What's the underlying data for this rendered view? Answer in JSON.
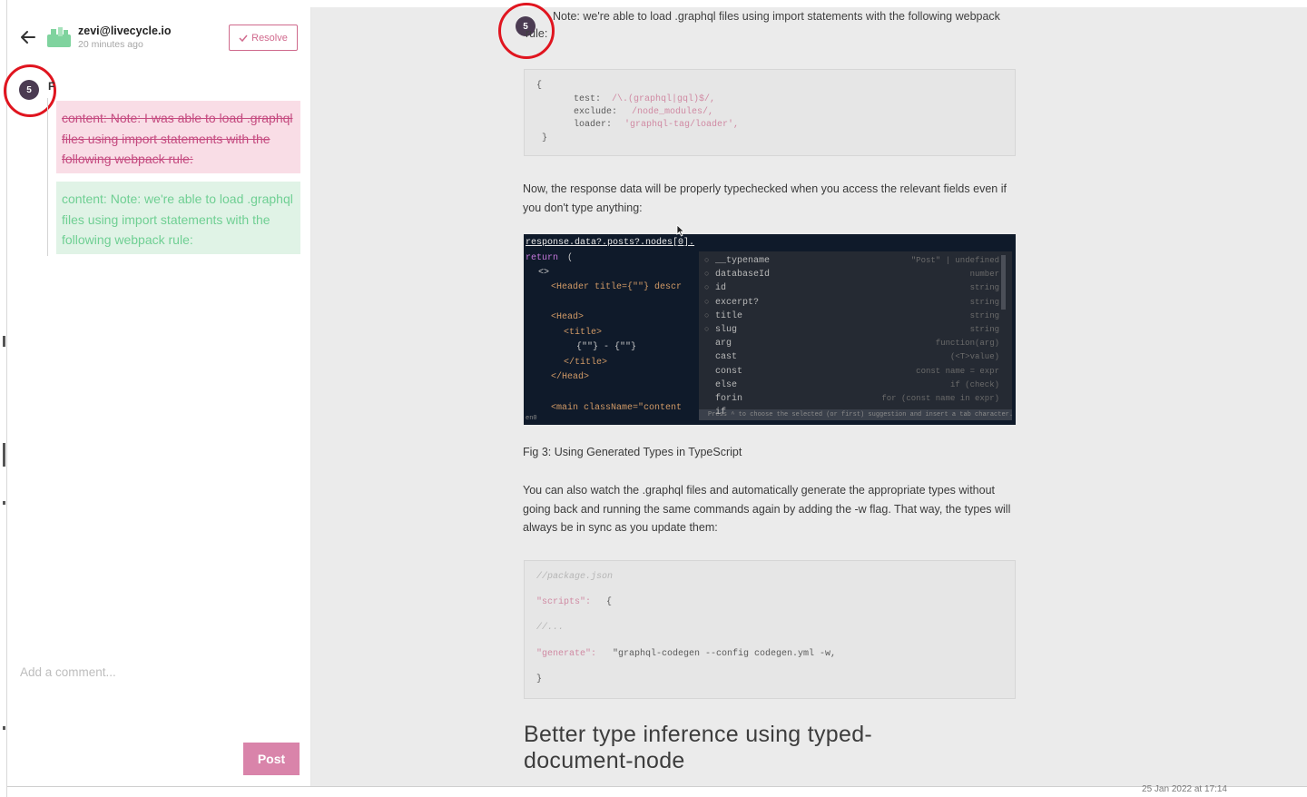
{
  "comment_panel": {
    "user": {
      "email": "zevi@livecycle.io",
      "time": "20 minutes ago"
    },
    "resolve_label": "Resolve",
    "marker_number": "5",
    "marker_letter": "F",
    "removed_text": "content: Note: I was able to load .graphql files using import statements with the following webpack rule:",
    "added_text": "content: Note: we're able to load .graphql files using import statements with the following webpack rule:",
    "comment_placeholder": "Add a comment...",
    "post_label": "Post"
  },
  "article": {
    "marker_number": "5",
    "intro_line": "Note: we're able to load .graphql files using import statements with the following webpack",
    "intro_cont": "rule:",
    "code1": {
      "open": "{",
      "test_key": "test:",
      "test_val": "/\\.(graphql|gql)$/,",
      "exclude_key": "exclude:",
      "exclude_val": "/node_modules/,",
      "loader_key": "loader:",
      "loader_val": "'graphql-tag/loader',",
      "close": "}"
    },
    "para1": "Now, the response data will be properly typechecked when you access the relevant fields even if you don't type anything:",
    "figure": {
      "line1": "response.data?.posts?.nodes[0].",
      "return_kw": "return",
      "return_paren": "(",
      "frag_open": "<>",
      "header_line": "<Header title={\"\"} descr",
      "head_open": "<Head>",
      "title_open": "<title>",
      "title_expr": "{\"\"} - {\"\"}",
      "title_close": "</title>",
      "head_close": "</Head>",
      "main_line": "<main className=\"content",
      "status_left": "en0",
      "suggestions": [
        {
          "name": "__typename",
          "type": "\"Post\" | undefined"
        },
        {
          "name": "databaseId",
          "type": "number"
        },
        {
          "name": "id",
          "type": "string"
        },
        {
          "name": "excerpt?",
          "type": "string"
        },
        {
          "name": "title",
          "type": "string"
        },
        {
          "name": "slug",
          "type": "string"
        },
        {
          "name": "arg",
          "type": "function(arg)"
        },
        {
          "name": "cast",
          "type": "(<T>value)"
        },
        {
          "name": "const",
          "type": "const name = expr"
        },
        {
          "name": "else",
          "type": "if (check)"
        },
        {
          "name": "forin",
          "type": "for (const name in expr)"
        },
        {
          "name": "if",
          "type": ""
        }
      ],
      "suggest_bar": "Press ^ to choose the selected (or first) suggestion and insert a tab character. Next Tip"
    },
    "caption": "Fig 3: Using Generated Types in TypeScript",
    "para2": "You can also watch the .graphql files and automatically generate the appropriate types without going back and running the same commands again by adding the -w flag. That way, the types will always be in sync as you update them:",
    "code2": {
      "comment": "//package.json",
      "scripts_key": "\"scripts\":",
      "scripts_brace": "{",
      "ellipsis": "//...",
      "generate_key": "\"generate\":",
      "generate_val": "\"graphql-codegen --config codegen.yml -w,",
      "close": "}"
    },
    "heading": "Better type inference using typed-document-node"
  },
  "footer": {
    "timestamp": "25 Jan 2022 at 17:14"
  },
  "colors": {
    "accent_pink": "#d984aa",
    "removed_bg": "#f9dde6",
    "added_bg": "#e0f3e6",
    "marker_ring": "#e0151f"
  }
}
